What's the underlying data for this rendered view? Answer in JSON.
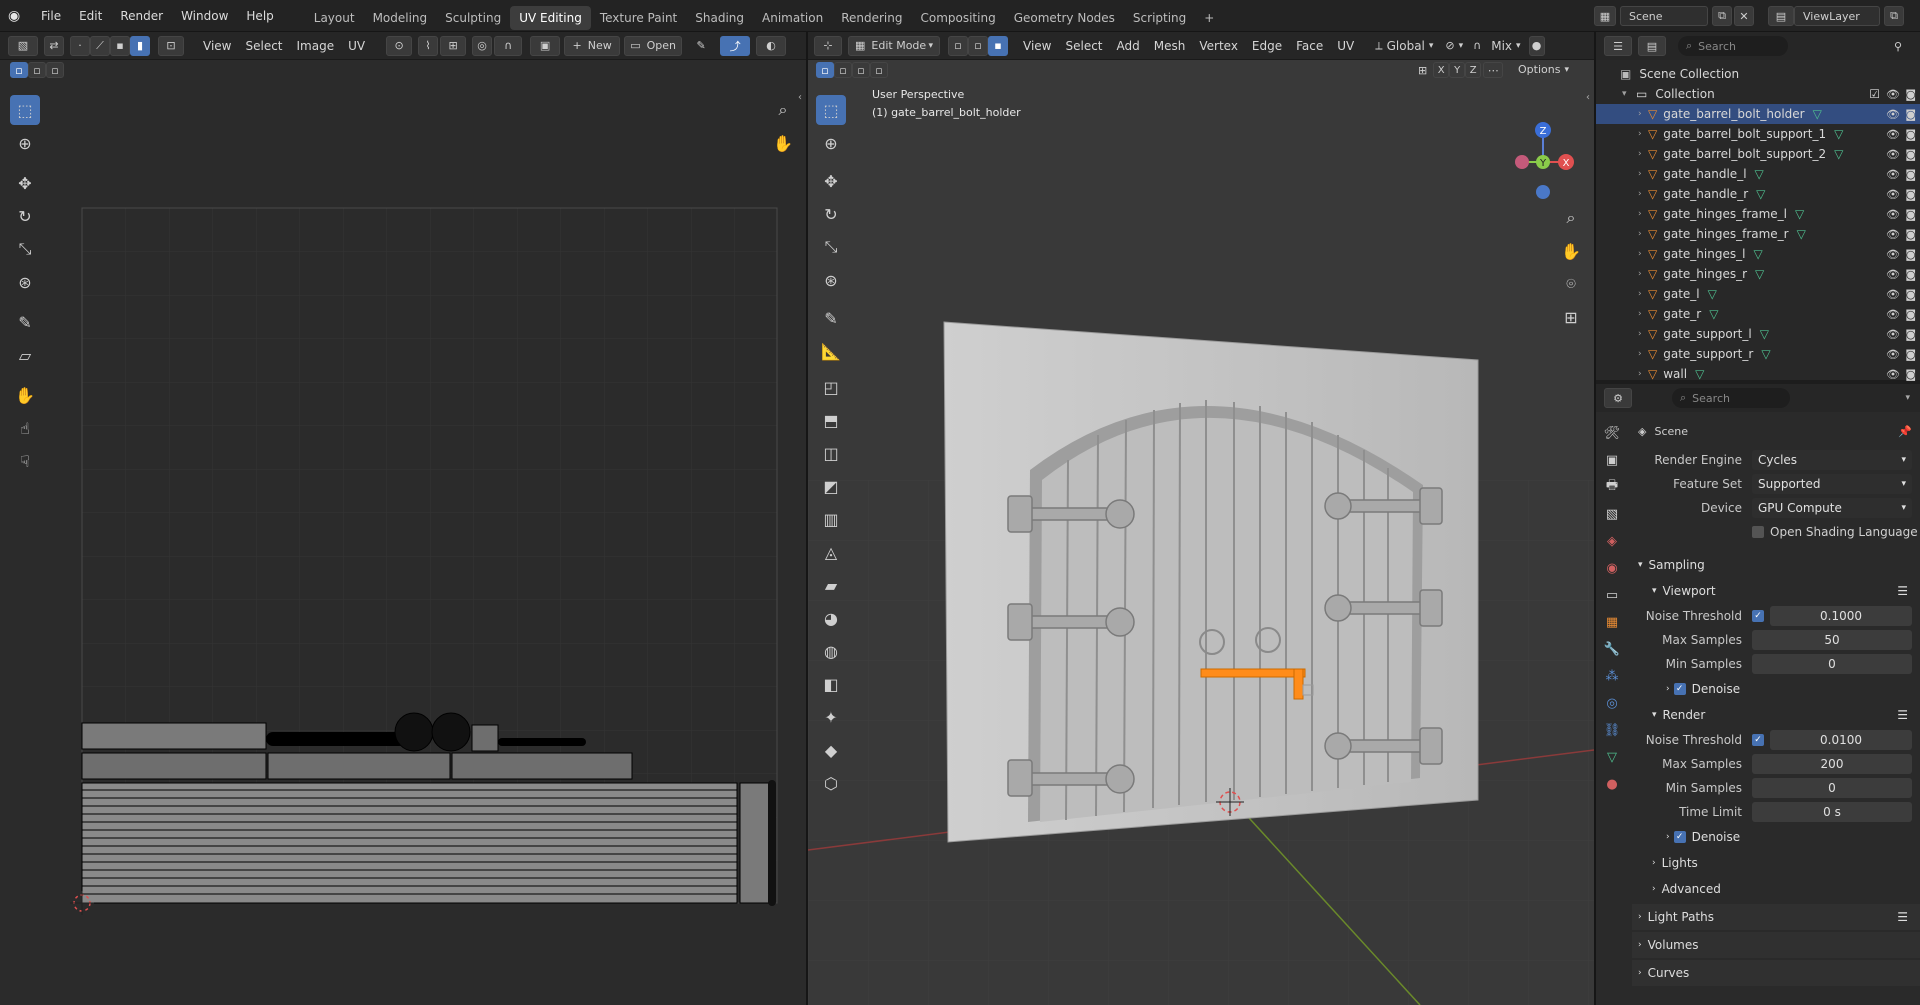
{
  "menu": {
    "items": [
      "File",
      "Edit",
      "Render",
      "Window",
      "Help"
    ],
    "workspaces": [
      "Layout",
      "Modeling",
      "Sculpting",
      "UV Editing",
      "Texture Paint",
      "Shading",
      "Animation",
      "Rendering",
      "Compositing",
      "Geometry Nodes",
      "Scripting"
    ],
    "active_workspace": "UV Editing",
    "add_tab": "+",
    "scene": "Scene",
    "view_layer": "ViewLayer"
  },
  "uv_editor": {
    "header": {
      "view": "View",
      "select": "Select",
      "image": "Image",
      "uv": "UV",
      "new": "New",
      "open": "Open"
    }
  },
  "viewport": {
    "header": {
      "mode": "Edit Mode",
      "menus": [
        "View",
        "Select",
        "Add",
        "Mesh",
        "Vertex",
        "Edge",
        "Face",
        "UV"
      ],
      "orientation": "Global",
      "shading_mode": "Mix",
      "options": "Options",
      "axes": [
        "X",
        "Y",
        "Z"
      ]
    },
    "overlay_title": "User Perspective",
    "overlay_object": "(1) gate_barrel_bolt_holder",
    "gizmo_axes": {
      "z": "Z",
      "y": "Y",
      "x": "X"
    }
  },
  "outliner": {
    "search_placeholder": "Search",
    "scene_collection": "Scene Collection",
    "collection": "Collection",
    "objects": [
      {
        "name": "gate_barrel_bolt_holder",
        "selected": true
      },
      {
        "name": "gate_barrel_bolt_support_1",
        "selected": false
      },
      {
        "name": "gate_barrel_bolt_support_2",
        "selected": false
      },
      {
        "name": "gate_handle_l",
        "selected": false
      },
      {
        "name": "gate_handle_r",
        "selected": false
      },
      {
        "name": "gate_hinges_frame_l",
        "selected": false
      },
      {
        "name": "gate_hinges_frame_r",
        "selected": false
      },
      {
        "name": "gate_hinges_l",
        "selected": false
      },
      {
        "name": "gate_hinges_r",
        "selected": false
      },
      {
        "name": "gate_l",
        "selected": false
      },
      {
        "name": "gate_r",
        "selected": false
      },
      {
        "name": "gate_support_l",
        "selected": false
      },
      {
        "name": "gate_support_r",
        "selected": false
      },
      {
        "name": "wall",
        "selected": false
      }
    ]
  },
  "properties": {
    "search_placeholder": "Search",
    "context": "Scene",
    "render_engine": {
      "label": "Render Engine",
      "value": "Cycles"
    },
    "feature_set": {
      "label": "Feature Set",
      "value": "Supported"
    },
    "device": {
      "label": "Device",
      "value": "GPU Compute"
    },
    "open_shading_language": "Open Shading Language",
    "sampling": "Sampling",
    "viewport": {
      "title": "Viewport",
      "noise_threshold": {
        "label": "Noise Threshold",
        "value": "0.1000"
      },
      "max_samples": {
        "label": "Max Samples",
        "value": "50"
      },
      "min_samples": {
        "label": "Min Samples",
        "value": "0"
      },
      "denoise": "Denoise"
    },
    "render": {
      "title": "Render",
      "noise_threshold": {
        "label": "Noise Threshold",
        "value": "0.0100"
      },
      "max_samples": {
        "label": "Max Samples",
        "value": "200"
      },
      "min_samples": {
        "label": "Min Samples",
        "value": "0"
      },
      "time_limit": {
        "label": "Time Limit",
        "value": "0 s"
      },
      "denoise": "Denoise"
    },
    "subpanels": [
      "Lights",
      "Advanced"
    ],
    "panels": [
      "Light Paths",
      "Volumes",
      "Curves"
    ]
  },
  "colors": {
    "accent": "#4772b3",
    "selection": "#334d80",
    "mesh_orange": "#e68a33",
    "edit_highlight": "#ff8c1a"
  }
}
